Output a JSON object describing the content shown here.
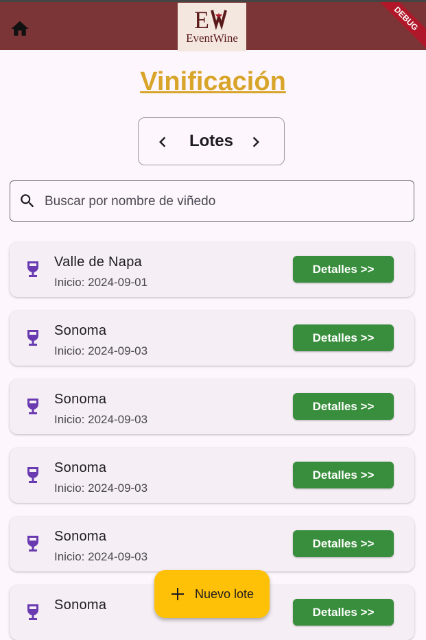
{
  "appbar": {
    "logo_text": "EventWine",
    "logo_mark": "EW",
    "debug_label": "DEBUG",
    "home_icon": "home-icon"
  },
  "page": {
    "title": "Vinificación",
    "section_label": "Lotes"
  },
  "search": {
    "placeholder": "Buscar por nombre de viñedo",
    "value": ""
  },
  "lots": [
    {
      "name": "Valle de Napa",
      "start": "Inicio: 2024-09-01",
      "button": "Detalles >>"
    },
    {
      "name": "Sonoma",
      "start": "Inicio: 2024-09-03",
      "button": "Detalles >>"
    },
    {
      "name": "Sonoma",
      "start": "Inicio: 2024-09-03",
      "button": "Detalles >>"
    },
    {
      "name": "Sonoma",
      "start": "Inicio: 2024-09-03",
      "button": "Detalles >>"
    },
    {
      "name": "Sonoma",
      "start": "Inicio: 2024-09-03",
      "button": "Detalles >>"
    },
    {
      "name": "Sonoma",
      "start": "",
      "button": "Detalles >>"
    }
  ],
  "fab": {
    "label": "Nuevo lote",
    "icon": "plus-icon"
  },
  "colors": {
    "appbar": "#7b3536",
    "title": "#d8a42a",
    "details_button": "#388e3c",
    "fab": "#ffc107",
    "wine_icon": "#6a3ab0"
  }
}
